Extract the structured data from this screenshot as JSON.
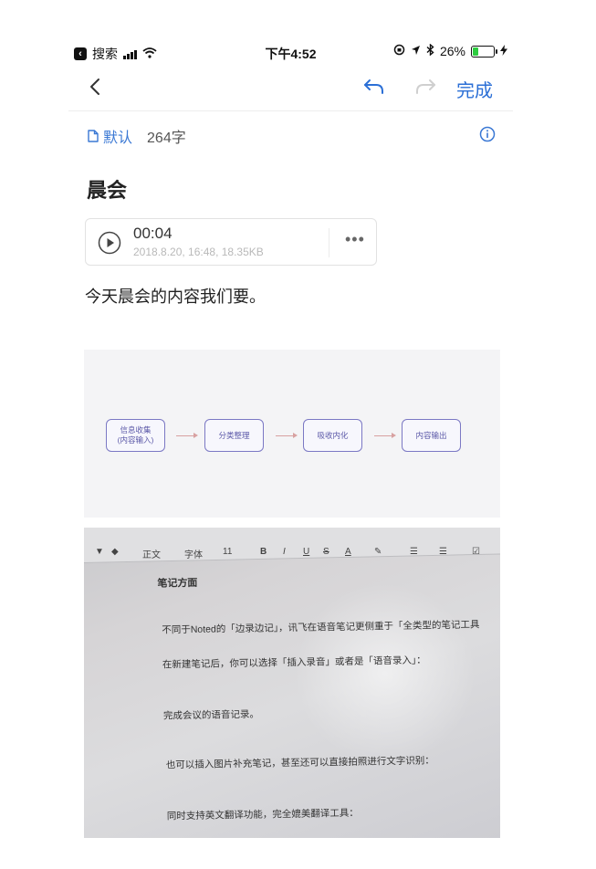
{
  "status_bar": {
    "app_back": "搜索",
    "time": "下午4:52",
    "battery": "26%",
    "battery_level": 0.26
  },
  "nav": {
    "done_label": "完成"
  },
  "meta": {
    "folder": "默认",
    "word_count": "264字"
  },
  "note": {
    "title": "晨会",
    "audio": {
      "duration": "00:04",
      "details": "2018.8.20, 16:48, 18.35KB"
    },
    "paragraph": "今天晨会的内容我们要。"
  },
  "flowchart": {
    "nodes": [
      "信息收集\n(内容输入)",
      "分类整理",
      "吸收内化",
      "内容输出"
    ]
  },
  "photo": {
    "toolbar": [
      "正文",
      "字体",
      "11",
      "B",
      "I",
      "U",
      "S",
      "A"
    ],
    "lines": [
      "笔记方面",
      "不同于Noted的「边录边记」，讯飞在语音笔记更侧重于「全类型的笔记工具",
      "在新建笔记后，你可以选择「插入录音」或者是「语音录入」：",
      "完成会议的语音记录。",
      "也可以插入图片补充笔记，甚至还可以直接拍照进行文字识别：",
      "同时支持英文翻译功能，完全媲美翻译工具："
    ]
  },
  "colors": {
    "accent": "#2b6fd6",
    "flow_node": "#7b78c4"
  }
}
